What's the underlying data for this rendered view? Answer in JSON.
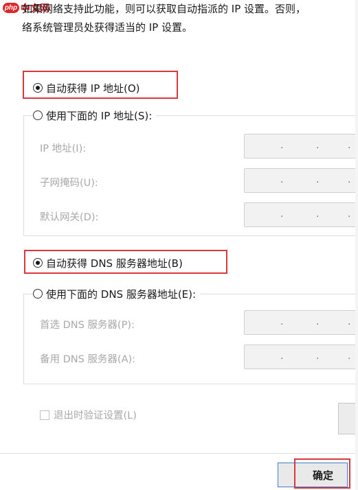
{
  "watermark": {
    "badge": "php",
    "name": "中文网"
  },
  "description": {
    "line1": "如果网络支持此功能，则可以获取自动指派的 IP 设置。否则，",
    "line2": "络系统管理员处获得适当的 IP 设置。"
  },
  "ip": {
    "auto_label": "自动获得 IP 地址(O)",
    "manual_label": "使用下面的 IP 地址(S):",
    "auto_selected": true,
    "fields": {
      "ip_address_label": "IP 地址(I):",
      "subnet_mask_label": "子网掩码(U):",
      "default_gateway_label": "默认网关(D):"
    }
  },
  "dns": {
    "auto_label": "自动获得 DNS 服务器地址(B)",
    "manual_label": "使用下面的 DNS 服务器地址(E):",
    "auto_selected": true,
    "fields": {
      "preferred_label": "首选 DNS 服务器(P):",
      "alternate_label": "备用 DNS 服务器(A):"
    }
  },
  "validate_on_exit": {
    "label": "退出时验证设置(L)",
    "checked": false
  },
  "buttons": {
    "ok_label": "确定"
  },
  "colors": {
    "highlight": "#d9363e",
    "focus_border": "#3c7fd1"
  },
  "icons": {
    "radio": "radio-button",
    "checkbox": "checkbox"
  }
}
